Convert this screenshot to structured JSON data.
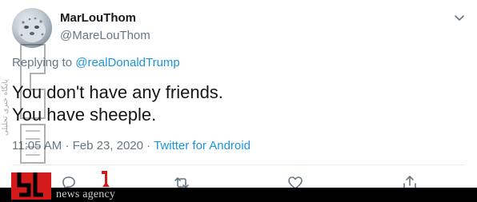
{
  "tweet": {
    "display_name": "MarLouThom",
    "handle": "@MareLouThom",
    "replying_prefix": "Replying to ",
    "replying_to": "@realDonaldTrump",
    "text_lines": [
      "You don't have any friends.",
      "You have sheeple."
    ],
    "timestamp": "11:05 AM · Feb 23, 2020 · ",
    "source": "Twitter for Android"
  },
  "icons": {
    "more": "chevron-down-icon",
    "reply": "reply-icon",
    "retweet": "retweet-icon",
    "like": "heart-icon",
    "share": "share-icon"
  },
  "watermark": {
    "text": "news agency",
    "vertical_text": "پایگاه خبری تحلیلی"
  },
  "colors": {
    "link": "#1b95e0",
    "secondary": "#657786",
    "primary_text": "#14171a",
    "divider": "#e6ecf0",
    "watermark_red": "#d21a1a",
    "watermark_bar": "#000000"
  }
}
